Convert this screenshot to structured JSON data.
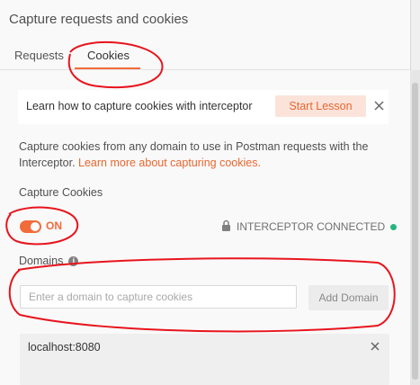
{
  "title": "Capture requests and cookies",
  "tabs": [
    {
      "label": "Requests"
    },
    {
      "label": "Cookies"
    }
  ],
  "active_tab": "Cookies",
  "lesson": {
    "text": "Learn how to capture cookies with interceptor",
    "button_label": "Start Lesson",
    "close_icon": "close-icon"
  },
  "description": {
    "text": "Capture cookies from any domain to use in Postman requests with the Interceptor.",
    "link_text": "Learn more about capturing cookies."
  },
  "capture_cookies": {
    "label": "Capture Cookies",
    "toggle_state": "ON",
    "status": "INTERCEPTOR CONNECTED"
  },
  "domains": {
    "label": "Domains",
    "input_placeholder": "Enter a domain to capture cookies",
    "input_value": "",
    "add_button_label": "Add Domain",
    "list": [
      {
        "domain": "localhost:8080"
      }
    ]
  },
  "colors": {
    "accent": "#f26b3a",
    "connected": "#26b47f",
    "annotation": "#e8141d"
  }
}
